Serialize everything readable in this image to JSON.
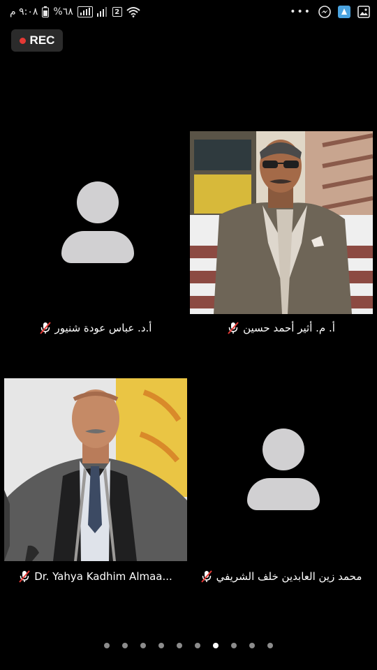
{
  "status_bar": {
    "time": "٩:٠٨ م",
    "battery": "%٦٨",
    "sim_badge": "2",
    "overflow": "•••"
  },
  "recording": {
    "label": "REC",
    "dot_color": "#e53935"
  },
  "participants": [
    {
      "name": "أ.د. عباس عودة شنيور",
      "video": "avatar",
      "muted": true
    },
    {
      "name": "أ. م. أثير أحمد حسين",
      "video": "photo",
      "muted": true
    },
    {
      "name": "Dr. Yahya Kadhim Almaa...",
      "video": "photo",
      "muted": true
    },
    {
      "name": "محمد زين العابدين خلف الشريفي",
      "video": "avatar",
      "muted": true
    }
  ],
  "pagination": {
    "total": 10,
    "current": 7
  },
  "colors": {
    "background": "#000000",
    "avatar": "#d1d0d2",
    "mute_slash": "#e53935"
  }
}
